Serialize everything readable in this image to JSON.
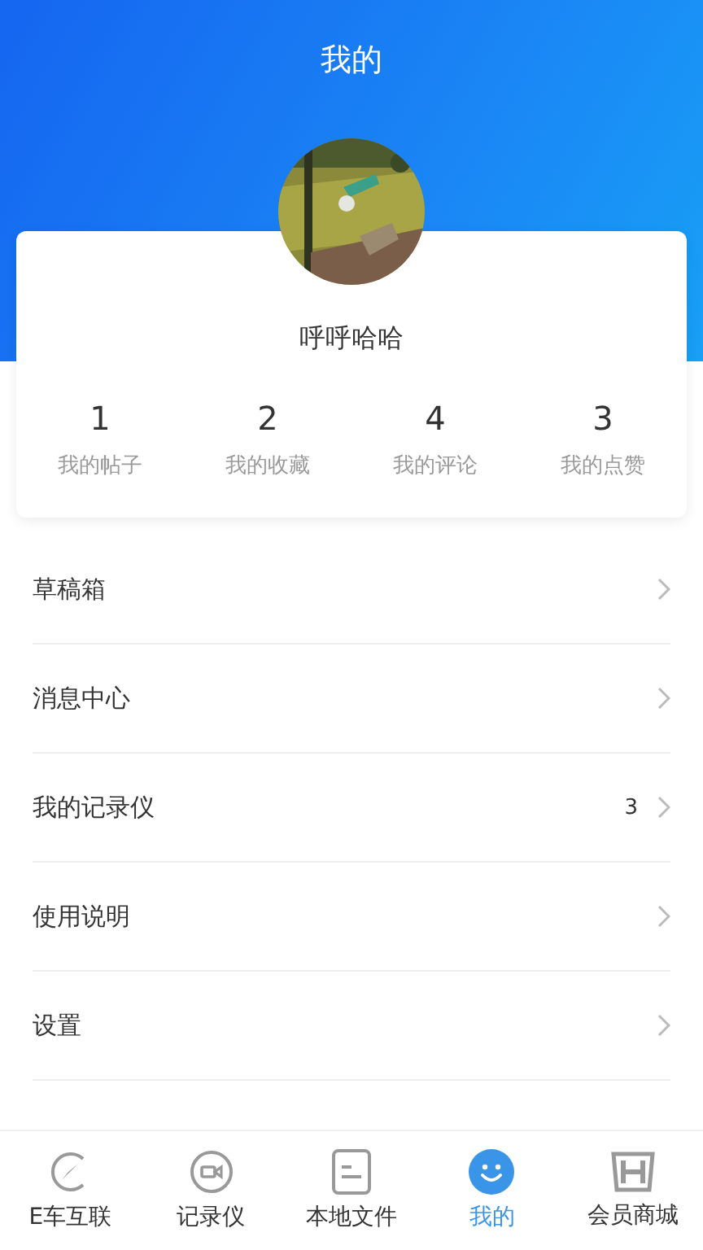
{
  "header": {
    "title": "我的"
  },
  "profile": {
    "name": "呼呼哈哈"
  },
  "stats": [
    {
      "count": "1",
      "label": "我的帖子"
    },
    {
      "count": "2",
      "label": "我的收藏"
    },
    {
      "count": "4",
      "label": "我的评论"
    },
    {
      "count": "3",
      "label": "我的点赞"
    }
  ],
  "menu": [
    {
      "label": "草稿箱"
    },
    {
      "label": "消息中心"
    },
    {
      "label": "我的记录仪",
      "badge": "3"
    },
    {
      "label": "使用说明"
    },
    {
      "label": "设置"
    }
  ],
  "tab_bar": [
    {
      "kind": "compass",
      "label": "E车互联",
      "selected": false
    },
    {
      "kind": "camera",
      "label": "记录仪",
      "selected": false
    },
    {
      "kind": "file",
      "label": "本地文件",
      "selected": false
    },
    {
      "kind": "smile",
      "label": "我的",
      "selected": true
    },
    {
      "kind": "brand",
      "label": "会员商城",
      "selected": false
    }
  ]
}
